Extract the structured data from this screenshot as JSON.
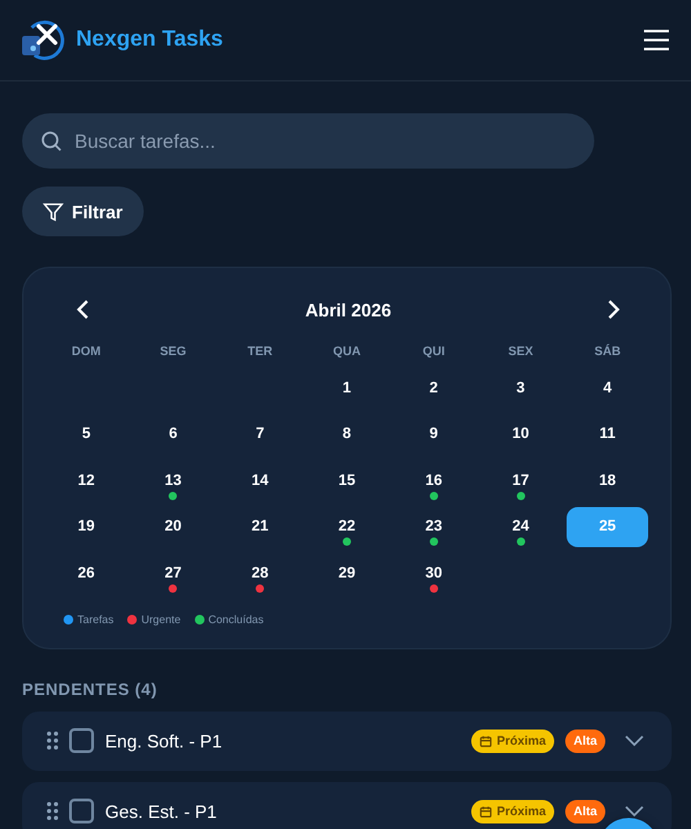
{
  "header": {
    "title": "Nexgen Tasks"
  },
  "search": {
    "placeholder": "Buscar tarefas..."
  },
  "filter_button": {
    "label": "Filtrar"
  },
  "calendar": {
    "month": "Abril 2026",
    "weekdays": [
      "DOM",
      "SEG",
      "TER",
      "QUA",
      "QUI",
      "SEX",
      "SÁB"
    ],
    "weeks": [
      [
        {
          "kind": "blank"
        },
        {
          "kind": "blank"
        },
        {
          "kind": "blank"
        },
        {
          "kind": "day",
          "day": "1",
          "selected": false
        },
        {
          "kind": "day",
          "day": "2",
          "selected": false
        },
        {
          "kind": "day",
          "day": "3",
          "selected": false
        },
        {
          "kind": "day",
          "day": "4",
          "selected": false
        }
      ],
      [
        {
          "kind": "day",
          "day": "5",
          "selected": false
        },
        {
          "kind": "day",
          "day": "6",
          "selected": false
        },
        {
          "kind": "day",
          "day": "7",
          "selected": false
        },
        {
          "kind": "day",
          "day": "8",
          "selected": false
        },
        {
          "kind": "day",
          "day": "9",
          "selected": false
        },
        {
          "kind": "day",
          "day": "10",
          "selected": false
        },
        {
          "kind": "day",
          "day": "11",
          "selected": false
        }
      ],
      [
        {
          "kind": "day",
          "day": "12",
          "selected": false
        },
        {
          "kind": "day",
          "day": "13",
          "selected": false,
          "color": "#22c55e"
        },
        {
          "kind": "day",
          "day": "14",
          "selected": false
        },
        {
          "kind": "day",
          "day": "15",
          "selected": false
        },
        {
          "kind": "day",
          "day": "16",
          "selected": false,
          "color": "#22c55e"
        },
        {
          "kind": "day",
          "day": "17",
          "selected": false,
          "color": "#22c55e"
        },
        {
          "kind": "day",
          "day": "18",
          "selected": false
        }
      ],
      [
        {
          "kind": "day",
          "day": "19",
          "selected": false
        },
        {
          "kind": "day",
          "day": "20",
          "selected": false
        },
        {
          "kind": "day",
          "day": "21",
          "selected": false
        },
        {
          "kind": "day",
          "day": "22",
          "selected": false,
          "color": "#22c55e"
        },
        {
          "kind": "day",
          "day": "23",
          "selected": false,
          "color": "#22c55e"
        },
        {
          "kind": "day",
          "day": "24",
          "selected": false,
          "color": "#22c55e"
        },
        {
          "kind": "day",
          "day": "25",
          "selected": true
        }
      ],
      [
        {
          "kind": "day",
          "day": "26",
          "selected": false
        },
        {
          "kind": "day",
          "day": "27",
          "selected": false,
          "color": "#ef3340"
        },
        {
          "kind": "day",
          "day": "28",
          "selected": false,
          "color": "#ef3340"
        },
        {
          "kind": "day",
          "day": "29",
          "selected": false
        },
        {
          "kind": "day",
          "day": "30",
          "selected": false,
          "color": "#ef3340"
        },
        {
          "kind": "blank"
        },
        {
          "kind": "blank"
        }
      ]
    ],
    "legend": [
      {
        "label": "Tarefas",
        "color": "#2196f3"
      },
      {
        "label": "Urgente",
        "color": "#ef3340"
      },
      {
        "label": "Concluídas",
        "color": "#22c55e"
      }
    ]
  },
  "section_title": "PENDENTES (4)",
  "tasks": [
    {
      "title": "Eng. Soft. - P1",
      "checked": false,
      "tags": [
        {
          "kind": "due",
          "label": "Próxima"
        },
        {
          "kind": "priority",
          "label": "Alta"
        }
      ]
    },
    {
      "title": "Ges. Est. - P1",
      "checked": false,
      "tags": [
        {
          "kind": "due",
          "label": "Próxima"
        },
        {
          "kind": "priority",
          "label": "Alta"
        }
      ]
    }
  ]
}
